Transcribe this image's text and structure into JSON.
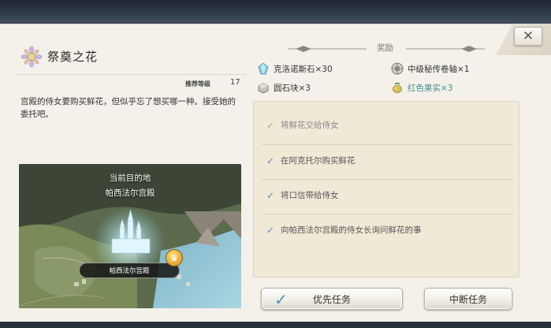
{
  "quest": {
    "title": "祭奠之花",
    "level_label": "推荐等级",
    "level_value": "17",
    "description": "宫殿的侍女要购买鲜花，但似乎忘了想买哪一种。接受她的委托吧。",
    "icon": "flower-quest-icon"
  },
  "map": {
    "destination_title": "当前目的地",
    "destination_name": "帕西法尔宫殿",
    "marker_label": "帕西法尔宫殿",
    "marker_icon": "crown-marker-icon"
  },
  "rewards": {
    "title": "奖励",
    "items": [
      {
        "label": "克洛诺斯石×30",
        "icon": "crystal-stone-icon",
        "color": "#333333"
      },
      {
        "label": "中级秘传卷轴×1",
        "icon": "scroll-icon",
        "color": "#333333"
      },
      {
        "label": "圆石块×3",
        "icon": "stone-block-icon",
        "color": "#333333"
      },
      {
        "label": "红色果实×3",
        "icon": "red-fruit-icon",
        "color": "#3f8e8e"
      }
    ]
  },
  "objectives": [
    {
      "label": "将鲜花交给侍女",
      "state": "pending"
    },
    {
      "label": "在阿克托尔购买鲜花",
      "state": "done"
    },
    {
      "label": "将口信带给侍女",
      "state": "done"
    },
    {
      "label": "向帕西法尔宫殿的侍女长询问鲜花的事",
      "state": "done"
    }
  ],
  "buttons": {
    "close": "✕",
    "priority": "优先任务",
    "abort": "中断任务"
  }
}
